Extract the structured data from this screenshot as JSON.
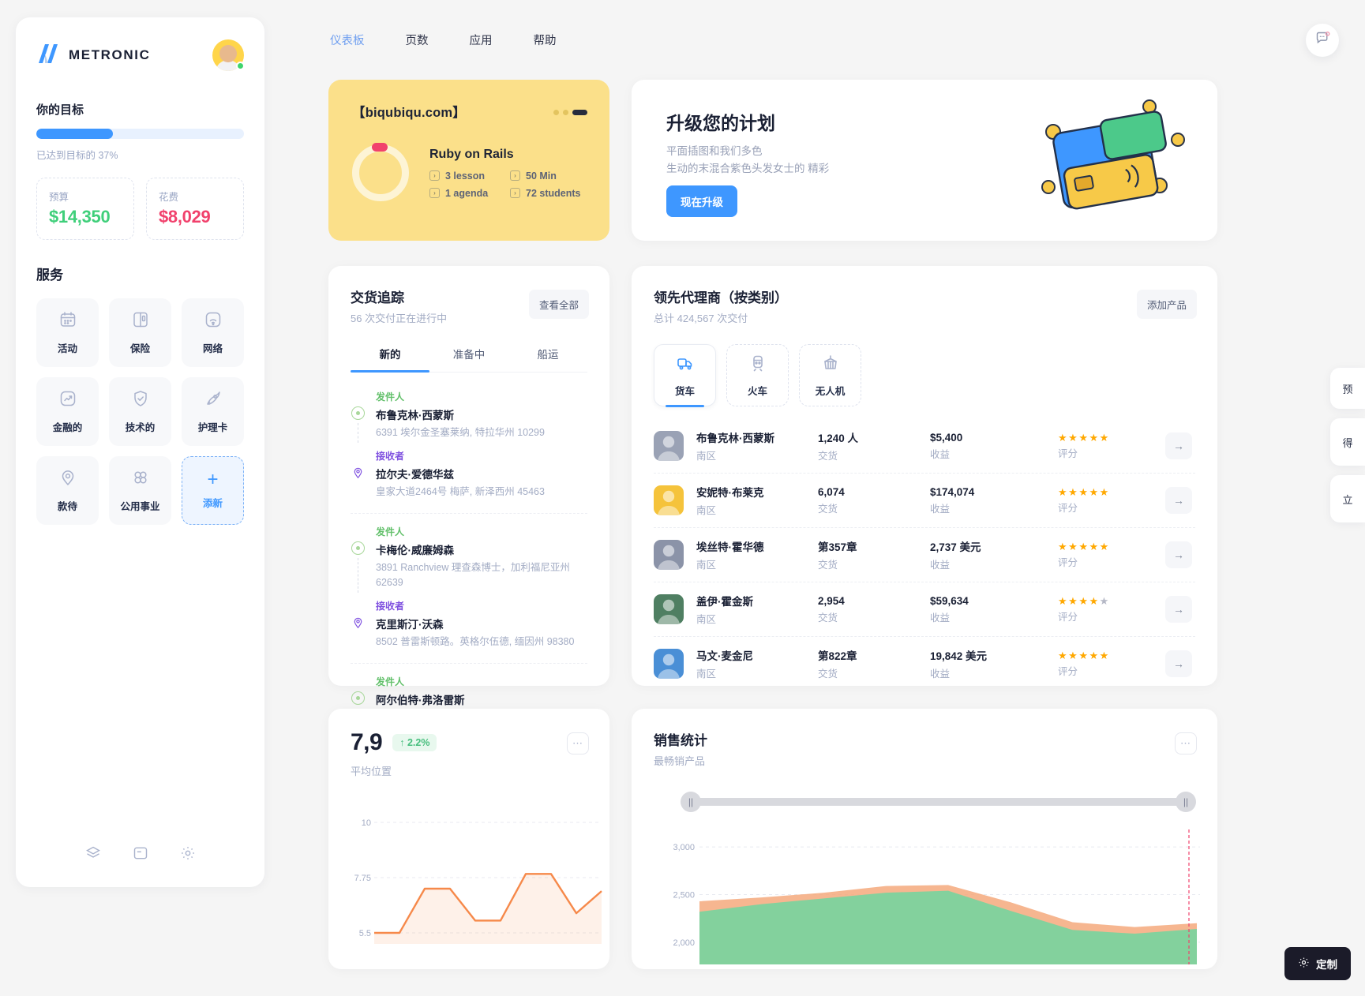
{
  "sidebar": {
    "brand": "METRONIC",
    "goal": {
      "title": "你的目标",
      "progress_pct": 37,
      "progress_label": "已达到目标的 37%",
      "budget_label": "预算",
      "budget_value": "$14,350",
      "spent_label": "花费",
      "spent_value": "$8,029"
    },
    "services_title": "服务",
    "services": [
      {
        "label": "活动",
        "icon": "calendar-icon"
      },
      {
        "label": "保险",
        "icon": "book-icon"
      },
      {
        "label": "网络",
        "icon": "wifi-icon"
      },
      {
        "label": "金融的",
        "icon": "chart-up-icon"
      },
      {
        "label": "技术的",
        "icon": "shield-check-icon"
      },
      {
        "label": "护理卡",
        "icon": "rocket-icon"
      },
      {
        "label": "款待",
        "icon": "location-pin-icon"
      },
      {
        "label": "公用事业",
        "icon": "four-circles-icon"
      },
      {
        "label": "添新",
        "icon": "plus-icon"
      }
    ],
    "footer_icons": [
      "layers-icon",
      "note-icon",
      "gear-icon"
    ]
  },
  "topnav": {
    "items": [
      {
        "label": "仪表板",
        "active": true
      },
      {
        "label": "页数",
        "active": false
      },
      {
        "label": "应用",
        "active": false
      },
      {
        "label": "帮助",
        "active": false
      }
    ],
    "chat_icon": "chat-bubble-icon"
  },
  "course_card": {
    "url": "【biqubiqu.com】",
    "name": "Ruby on Rails",
    "meta": [
      "3 lesson",
      "50 Min",
      "1 agenda",
      "72 students"
    ]
  },
  "upgrade_card": {
    "title": "升级您的计划",
    "line1": "平面插图和我们多色",
    "line2": "生动的末混合紫色头发女士的 精彩",
    "button": "现在升级"
  },
  "delivery": {
    "title": "交货追踪",
    "subtitle_count": "56",
    "subtitle": "56 次交付正在进行中",
    "view_all": "查看全部",
    "tabs": [
      {
        "label": "新的",
        "active": true
      },
      {
        "label": "准备中",
        "active": false
      },
      {
        "label": "船运",
        "active": false
      }
    ],
    "sender_label": "发件人",
    "receiver_label": "接收者",
    "groups": [
      {
        "sender_name": "布鲁克林·西蒙斯",
        "sender_addr": "6391 埃尔金圣塞莱纳, 特拉华州 10299",
        "receiver_name": "拉尔夫·爱德华兹",
        "receiver_addr": "皇家大道2464号 梅萨, 新泽西州 45463"
      },
      {
        "sender_name": "卡梅伦·威廉姆森",
        "sender_addr": "3891 Ranchview 理查森博士，加利福尼亚州 62639",
        "receiver_name": "克里斯汀·沃森",
        "receiver_addr": "8502 普雷斯顿路。英格尔伍德, 缅因州 98380"
      },
      {
        "sender_name": "阿尔伯特·弗洛雷斯",
        "sender_addr": "",
        "receiver_name": "",
        "receiver_addr": ""
      }
    ]
  },
  "agents": {
    "title": "领先代理商（按类别）",
    "subtitle": "总计 424,567 次交付",
    "add_product": "添加产品",
    "modes": [
      {
        "label": "货车",
        "icon": "truck-icon",
        "active": true
      },
      {
        "label": "火车",
        "icon": "train-icon",
        "active": false
      },
      {
        "label": "无人机",
        "icon": "container-icon",
        "active": false
      }
    ],
    "col_delivery": "交货",
    "col_revenue": "收益",
    "col_rating": "评分",
    "rows": [
      {
        "name": "布鲁克林·西蒙斯",
        "region": "南区",
        "delivery": "1,240 人",
        "revenue": "$5,400",
        "stars": 5,
        "avatar_bg": "#9aa2b5"
      },
      {
        "name": "安妮特·布莱克",
        "region": "南区",
        "delivery": "6,074",
        "revenue": "$174,074",
        "stars": 5,
        "avatar_bg": "#f5c33b"
      },
      {
        "name": "埃丝特·霍华德",
        "region": "南区",
        "delivery": "第357章",
        "revenue": "2,737 美元",
        "stars": 5,
        "avatar_bg": "#8b93a8"
      },
      {
        "name": "盖伊·霍金斯",
        "region": "南区",
        "delivery": "2,954",
        "revenue": "$59,634",
        "stars": 4,
        "avatar_bg": "#4f7f62"
      },
      {
        "name": "马文·麦金尼",
        "region": "南区",
        "delivery": "第822章",
        "revenue": "19,842 美元",
        "stars": 5,
        "avatar_bg": "#4a8fd6"
      }
    ],
    "go_icon": "arrow-right-icon"
  },
  "position_card": {
    "value": "7,9",
    "change": "↑ 2.2%",
    "subtitle": "平均位置",
    "more_icon": "ellipsis-icon",
    "chart_data": {
      "type": "line",
      "title": "平均位置",
      "ylabel": "",
      "xlabel": "",
      "yticks": [
        10,
        7.75,
        5.5
      ],
      "ylim": [
        5.5,
        10
      ],
      "x": [
        0,
        1,
        2,
        3,
        4,
        5,
        6,
        7,
        8,
        9
      ],
      "series": [
        {
          "name": "position",
          "values": [
            5.5,
            5.5,
            7.3,
            7.3,
            6.0,
            6.0,
            7.9,
            7.9,
            6.3,
            7.2
          ],
          "color": "#f6894a"
        }
      ],
      "grid": true,
      "legend": "none"
    }
  },
  "sales_card": {
    "title": "销售统计",
    "subtitle": "最畅销产品",
    "more_icon": "ellipsis-icon",
    "chart_data": {
      "type": "area",
      "title": "销售统计",
      "ylabel": "",
      "xlabel": "",
      "yticks": [
        3000,
        2500,
        2000
      ],
      "ylim": [
        2000,
        3000
      ],
      "x": [
        0,
        1,
        2,
        3,
        4,
        5,
        6,
        7,
        8
      ],
      "series": [
        {
          "name": "series-a",
          "values": [
            2430,
            2470,
            2520,
            2590,
            2600,
            2420,
            2210,
            2160,
            2200
          ],
          "color": "#f5a97c"
        },
        {
          "name": "series-b",
          "values": [
            2320,
            2400,
            2460,
            2520,
            2540,
            2330,
            2130,
            2090,
            2140
          ],
          "color": "#6fd6a0"
        }
      ],
      "grid": true,
      "legend": "none",
      "slider_range": [
        0,
        100
      ]
    }
  },
  "right_rail": [
    {
      "text": "预"
    },
    {
      "text": "得"
    },
    {
      "text": "立"
    }
  ],
  "customize_button": {
    "label": "定制",
    "icon": "gear-icon"
  },
  "colors": {
    "accent": "#3e97ff",
    "green": "#3fcf7a",
    "red": "#f1416c",
    "yellow": "#fbe08a",
    "star": "#ffa800"
  }
}
